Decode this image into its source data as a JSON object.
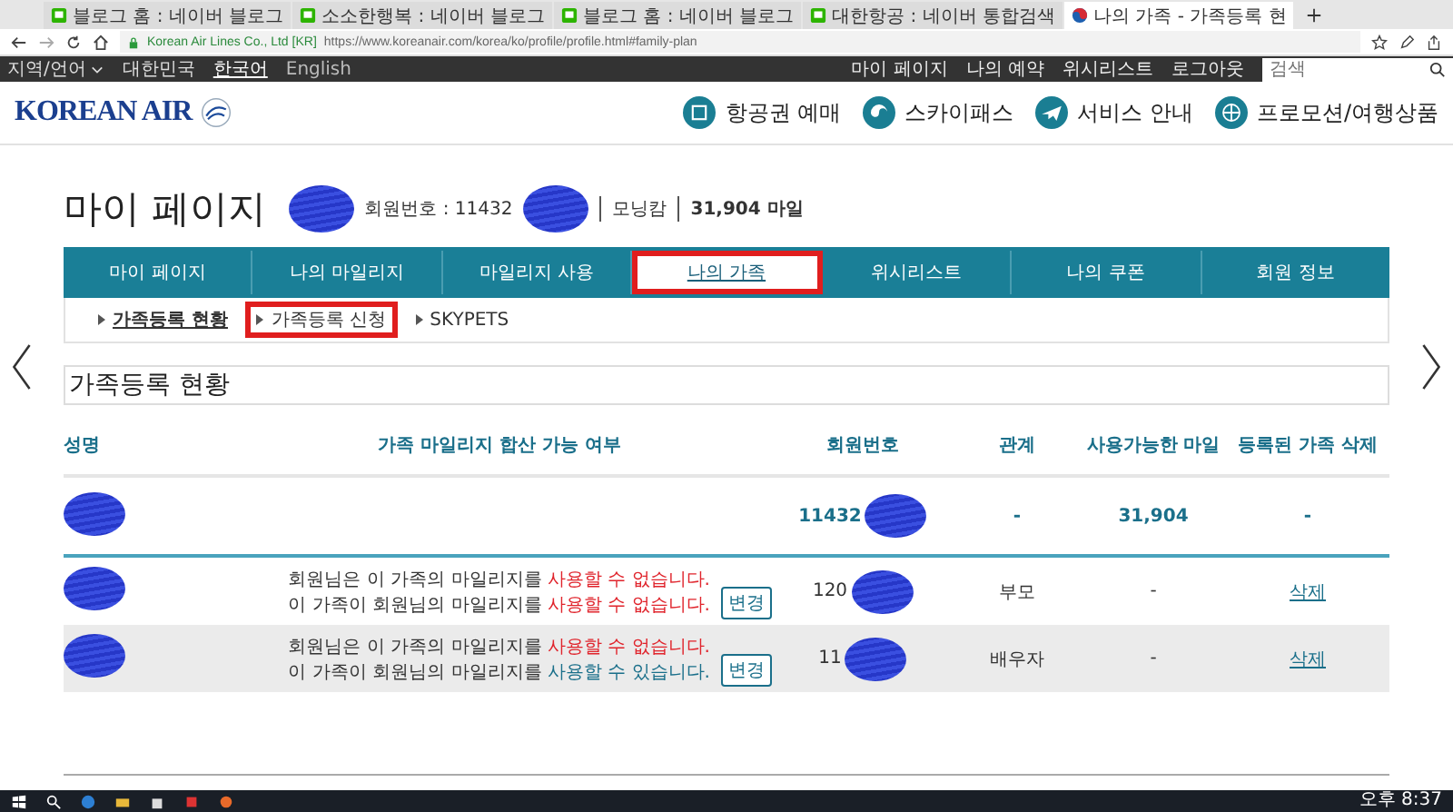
{
  "browser": {
    "tabs": [
      {
        "title": "블로그 홈 : 네이버 블로그",
        "kind": "naver",
        "selected": false
      },
      {
        "title": "소소한행복 : 네이버 블로그",
        "kind": "naver",
        "selected": false
      },
      {
        "title": "블로그 홈 : 네이버 블로그",
        "kind": "naver",
        "selected": false
      },
      {
        "title": "대한항공 : 네이버 통합검색",
        "kind": "naver",
        "selected": false
      },
      {
        "title": "나의 가족 - 가족등록 현",
        "kind": "airline",
        "selected": true
      }
    ],
    "site_identity": "Korean Air Lines Co., Ltd [KR]",
    "url": "https://www.koreanair.com/korea/ko/profile/profile.html#family-plan"
  },
  "utility_bar": {
    "region_label": "지역/언어",
    "region": "대한민국",
    "languages": [
      {
        "label": "한국어",
        "selected": true
      },
      {
        "label": "English",
        "selected": false
      }
    ],
    "links": [
      "마이 페이지",
      "나의 예약",
      "위시리스트",
      "로그아웃"
    ],
    "search": {
      "placeholder": "검색"
    }
  },
  "header": {
    "logo": "KOREAN AIR",
    "nav": [
      {
        "label": "항공권 예매",
        "kind": "calendar"
      },
      {
        "label": "스카이패스",
        "kind": "swirl"
      },
      {
        "label": "서비스 안내",
        "kind": "plane"
      },
      {
        "label": "프로모션/여행상품",
        "kind": "globe"
      }
    ]
  },
  "profile": {
    "title": "마이 페이지",
    "member_label": "회원번호 : 11432",
    "tier": "모닝캄",
    "miles": "31,904 마일"
  },
  "tabs": [
    {
      "label": "마이 페이지",
      "selected": false,
      "highlighted": false
    },
    {
      "label": "나의 마일리지",
      "selected": false,
      "highlighted": false
    },
    {
      "label": "마일리지 사용",
      "selected": false,
      "highlighted": false
    },
    {
      "label": "나의 가족",
      "selected": true,
      "highlighted": true
    },
    {
      "label": "위시리스트",
      "selected": false,
      "highlighted": false
    },
    {
      "label": "나의 쿠폰",
      "selected": false,
      "highlighted": false
    },
    {
      "label": "회원 정보",
      "selected": false,
      "highlighted": false
    }
  ],
  "subtabs": [
    {
      "label": "가족등록 현황",
      "selected": true,
      "highlighted": false
    },
    {
      "label": "가족등록 신청",
      "selected": false,
      "highlighted": true
    },
    {
      "label": "SKYPETS",
      "selected": false,
      "highlighted": false
    }
  ],
  "section_title": "가족등록 현황",
  "table": {
    "columns": [
      "성명",
      "가족 마일리지 합산 가능 여부",
      "회원번호",
      "관계",
      "사용가능한 마일",
      "등록된 가족 삭제"
    ],
    "rows": [
      {
        "kind": "self",
        "permissions": [],
        "member_no": "11432",
        "relation": "-",
        "miles": "31,904",
        "delete": "-"
      },
      {
        "kind": "family",
        "permissions": [
          {
            "text": "회원님은 이 가족의 마일리지를",
            "status": "사용할 수 없습니다.",
            "allowed": false
          },
          {
            "text": "이 가족이 회원님의 마일리지를",
            "status": "사용할 수 없습니다.",
            "allowed": false
          }
        ],
        "change_button": "변경",
        "member_no": "120",
        "relation": "부모",
        "miles": "-",
        "delete": "삭제"
      },
      {
        "kind": "family",
        "permissions": [
          {
            "text": "회원님은 이 가족의 마일리지를",
            "status": "사용할 수 없습니다.",
            "allowed": false
          },
          {
            "text": "이 가족이 회원님의 마일리지를",
            "status": "사용할 수 있습니다.",
            "allowed": true
          }
        ],
        "change_button": "변경",
        "member_no": "11",
        "relation": "배우자",
        "miles": "-",
        "delete": "삭제"
      }
    ]
  },
  "taskbar": {
    "clock": "오후 8:37"
  }
}
